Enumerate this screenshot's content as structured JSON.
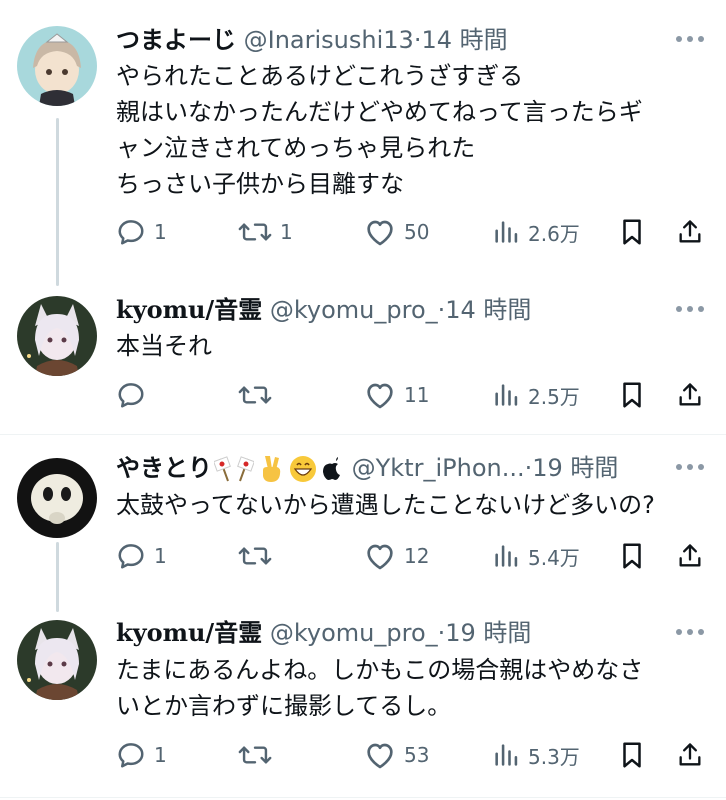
{
  "tweets": [
    {
      "name": "つまよーじ",
      "handle": "@Inarisushi13",
      "time": "14 時間",
      "lines": [
        "やられたことあるけどこれうざすぎる",
        "親はいなかったんだけどやめてねって言ったらギ",
        "ャン泣きされてめっちゃ見られた",
        "ちっさい子供から目離すな"
      ],
      "reply_count": "1",
      "retweet_count": "1",
      "like_count": "50",
      "view_count": "2.6万"
    },
    {
      "name": "kyomu/音霊",
      "handle": "@kyomu_pro_",
      "time": "14 時間",
      "lines": [
        "本当それ"
      ],
      "reply_count": "",
      "retweet_count": "",
      "like_count": "11",
      "view_count": "2.5万"
    },
    {
      "name": "やきとり",
      "name_emoji": [
        "flags-icon",
        "victory-hand-icon",
        "grinning-face-icon",
        "apple-logo-icon"
      ],
      "handle": "@Yktr_iPhon...",
      "time": "19 時間",
      "lines": [
        "太鼓やってないから遭遇したことないけど多いの?"
      ],
      "reply_count": "1",
      "retweet_count": "",
      "like_count": "12",
      "view_count": "5.4万"
    },
    {
      "name": "kyomu/音霊",
      "handle": "@kyomu_pro_",
      "time": "19 時間",
      "lines": [
        "たまにあるんよね。しかもこの場合親はやめなさ",
        "いとか言わずに撮影してるし。"
      ],
      "reply_count": "1",
      "retweet_count": "",
      "like_count": "53",
      "view_count": "5.3万"
    }
  ],
  "colors": {
    "text": "#0f1419",
    "secondary": "#536471",
    "thread_line": "#cfd9de",
    "divider": "#eff3f4"
  }
}
